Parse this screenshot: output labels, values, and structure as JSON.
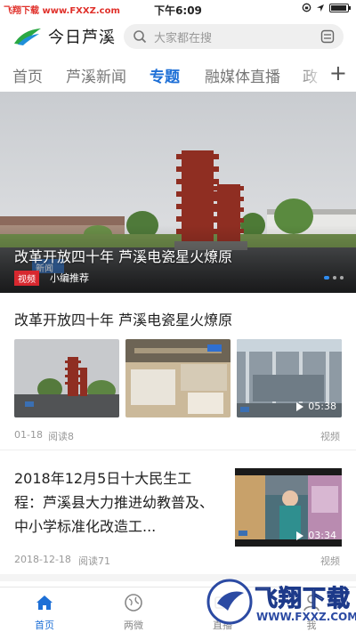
{
  "status_bar": {
    "left_text": "飞翔下载 www.FXXZ.com",
    "time": "下午6:09"
  },
  "header": {
    "app_name": "今日芦溪",
    "search_placeholder": "大家都在搜"
  },
  "tabs": [
    {
      "label": "首页",
      "active": false
    },
    {
      "label": "芦溪新闻",
      "active": false
    },
    {
      "label": "专题",
      "active": true
    },
    {
      "label": "融媒体直播",
      "active": false
    },
    {
      "label": "政",
      "active": false
    }
  ],
  "tab_add": "+",
  "banner": {
    "title": "改革开放四十年   芦溪电瓷星火燎原",
    "tag": "视频",
    "subtitle": "小编推荐",
    "sign_text": "新闻"
  },
  "article1": {
    "title": "改革开放四十年   芦溪电瓷星火燎原",
    "video_duration": "05:38",
    "date": "01-18",
    "reads": "阅读8",
    "type": "视频"
  },
  "article2": {
    "title": "2018年12月5日十大民生工程：芦溪县大力推进幼教普及、中小学标准化改造工...",
    "video_duration": "03:34",
    "date": "2018-12-18",
    "reads": "阅读71",
    "type": "视频"
  },
  "bottom_nav": [
    {
      "label": "首页",
      "icon": "home-icon",
      "active": true
    },
    {
      "label": "两微",
      "icon": "globe-icon",
      "active": false
    },
    {
      "label": "直播",
      "icon": "live-icon",
      "active": false
    },
    {
      "label": "我",
      "icon": "user-icon",
      "active": false
    }
  ],
  "watermark": {
    "text": "飞翔下载",
    "url": "WWW.FXXZ.COM"
  },
  "colors": {
    "accent": "#1d6fd6",
    "tag_red": "#d7282f"
  }
}
